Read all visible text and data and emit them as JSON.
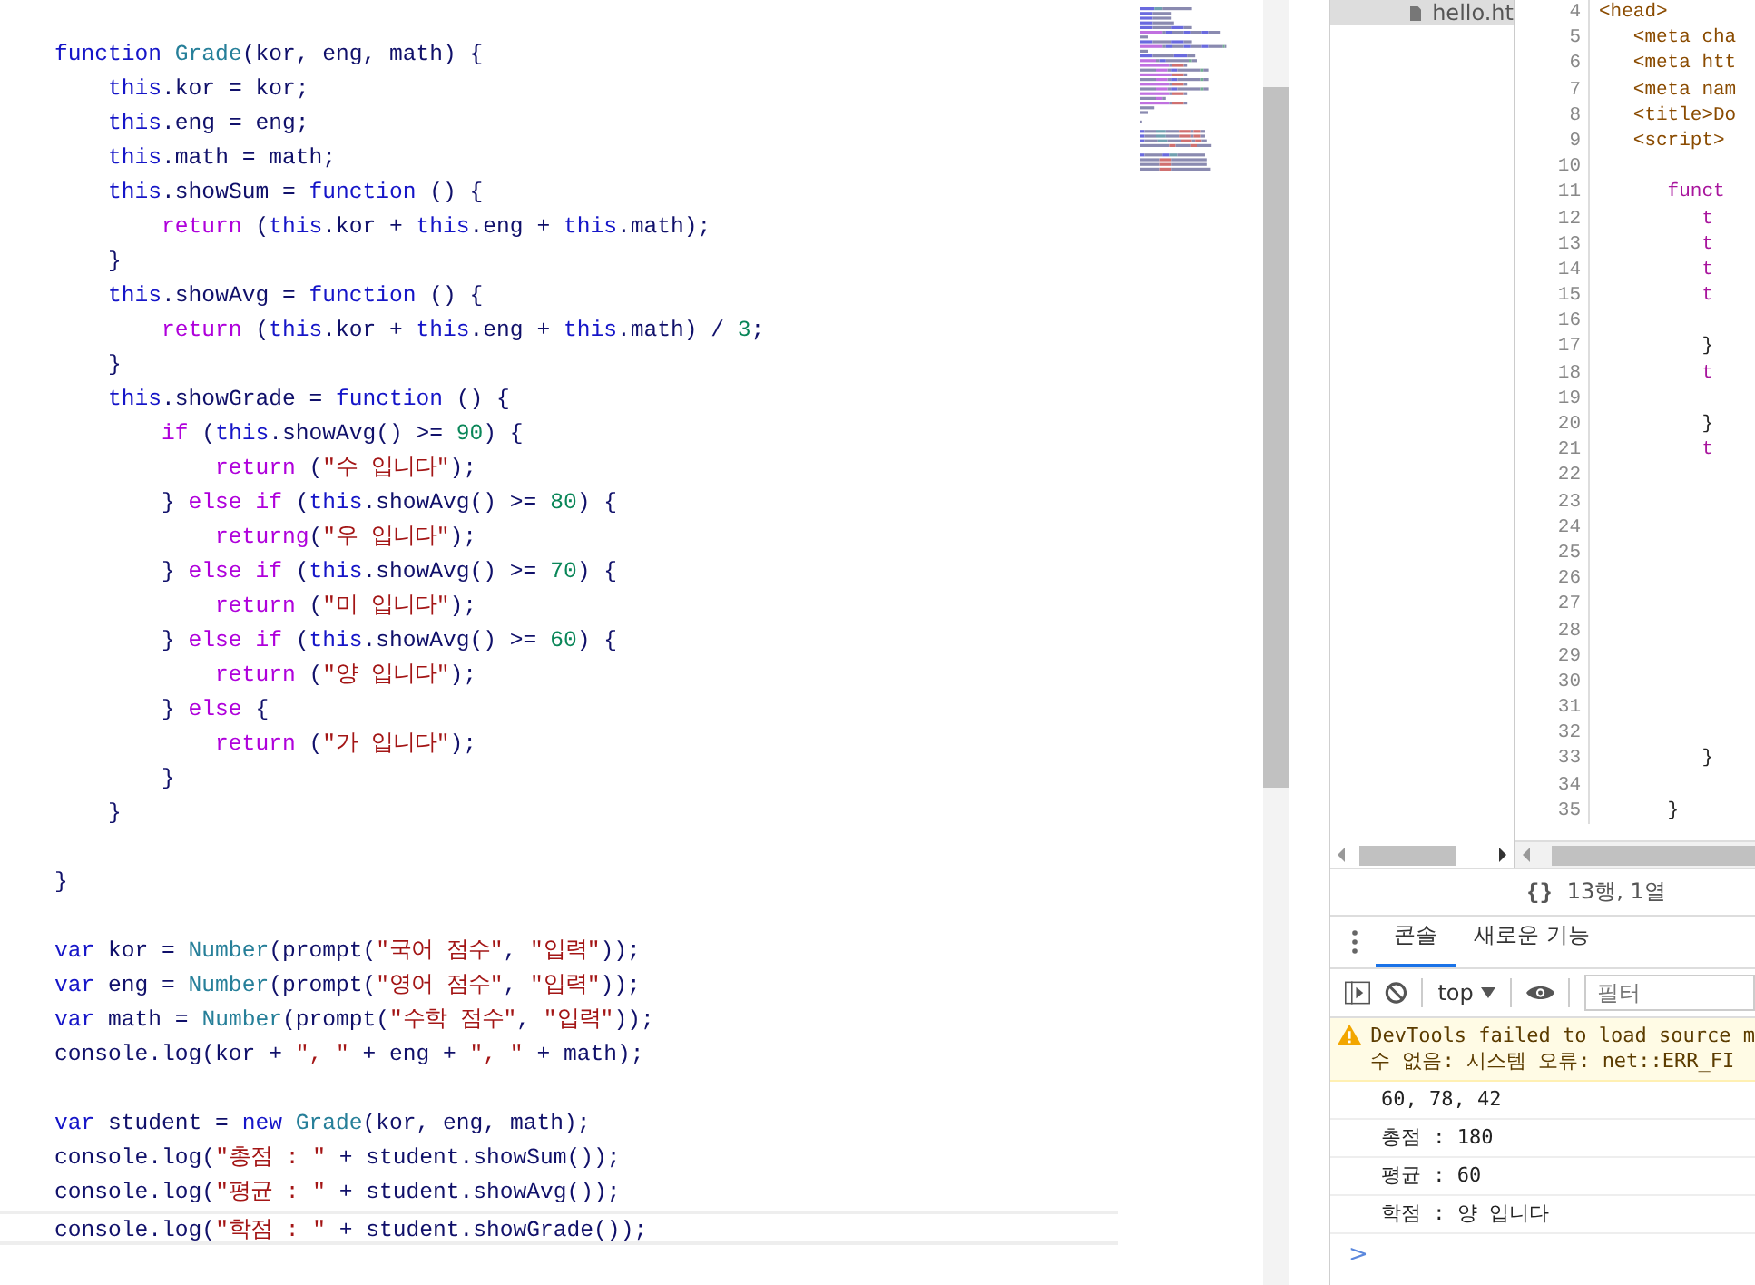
{
  "editor": {
    "blocks": [
      {
        "lines": [
          {
            "tokens": [
              {
                "kind": "kw",
                "text": "function "
              },
              {
                "kind": "type",
                "text": "Grade"
              },
              {
                "kind": "plain",
                "text": "(kor, eng, math) {"
              }
            ]
          },
          {
            "tokens": [
              {
                "kind": "kw",
                "text": "    this"
              },
              {
                "kind": "plain",
                "text": ".kor = kor;"
              }
            ]
          },
          {
            "tokens": [
              {
                "kind": "kw",
                "text": "    this"
              },
              {
                "kind": "plain",
                "text": ".eng = eng;"
              }
            ]
          },
          {
            "tokens": [
              {
                "kind": "kw",
                "text": "    this"
              },
              {
                "kind": "plain",
                "text": ".math = math;"
              }
            ]
          },
          {
            "tokens": [
              {
                "kind": "kw",
                "text": "    this"
              },
              {
                "kind": "plain",
                "text": ".showSum = "
              },
              {
                "kind": "kw",
                "text": "function"
              },
              {
                "kind": "plain",
                "text": " () {"
              }
            ]
          },
          {
            "tokens": [
              {
                "kind": "ctl",
                "text": "        return"
              },
              {
                "kind": "plain",
                "text": " ("
              },
              {
                "kind": "kw",
                "text": "this"
              },
              {
                "kind": "plain",
                "text": ".kor + "
              },
              {
                "kind": "kw",
                "text": "this"
              },
              {
                "kind": "plain",
                "text": ".eng + "
              },
              {
                "kind": "kw",
                "text": "this"
              },
              {
                "kind": "plain",
                "text": ".math);"
              }
            ]
          },
          {
            "tokens": [
              {
                "kind": "plain",
                "text": "    }"
              }
            ]
          },
          {
            "tokens": [
              {
                "kind": "kw",
                "text": "    this"
              },
              {
                "kind": "plain",
                "text": ".showAvg = "
              },
              {
                "kind": "kw",
                "text": "function"
              },
              {
                "kind": "plain",
                "text": " () {"
              }
            ]
          },
          {
            "tokens": [
              {
                "kind": "ctl",
                "text": "        return"
              },
              {
                "kind": "plain",
                "text": " ("
              },
              {
                "kind": "kw",
                "text": "this"
              },
              {
                "kind": "plain",
                "text": ".kor + "
              },
              {
                "kind": "kw",
                "text": "this"
              },
              {
                "kind": "plain",
                "text": ".eng + "
              },
              {
                "kind": "kw",
                "text": "this"
              },
              {
                "kind": "plain",
                "text": ".math) / "
              },
              {
                "kind": "num",
                "text": "3"
              },
              {
                "kind": "plain",
                "text": ";"
              }
            ]
          },
          {
            "tokens": [
              {
                "kind": "plain",
                "text": "    }"
              }
            ]
          },
          {
            "tokens": [
              {
                "kind": "kw",
                "text": "    this"
              },
              {
                "kind": "plain",
                "text": ".showGrade = "
              },
              {
                "kind": "kw",
                "text": "function"
              },
              {
                "kind": "plain",
                "text": " () {"
              }
            ]
          },
          {
            "tokens": [
              {
                "kind": "ctl",
                "text": "        if"
              },
              {
                "kind": "plain",
                "text": " ("
              },
              {
                "kind": "kw",
                "text": "this"
              },
              {
                "kind": "plain",
                "text": ".showAvg() >= "
              },
              {
                "kind": "num",
                "text": "90"
              },
              {
                "kind": "plain",
                "text": ") {"
              }
            ]
          },
          {
            "tokens": [
              {
                "kind": "ctl",
                "text": "            return"
              },
              {
                "kind": "plain",
                "text": " ("
              },
              {
                "kind": "str",
                "text": "\"수 입니다\""
              },
              {
                "kind": "plain",
                "text": ");"
              }
            ]
          },
          {
            "tokens": [
              {
                "kind": "plain",
                "text": "        } "
              },
              {
                "kind": "ctl",
                "text": "else if"
              },
              {
                "kind": "plain",
                "text": " ("
              },
              {
                "kind": "kw",
                "text": "this"
              },
              {
                "kind": "plain",
                "text": ".showAvg() >= "
              },
              {
                "kind": "num",
                "text": "80"
              },
              {
                "kind": "plain",
                "text": ") {"
              }
            ]
          },
          {
            "tokens": [
              {
                "kind": "ctl",
                "text": "            returng"
              },
              {
                "kind": "plain",
                "text": "("
              },
              {
                "kind": "str",
                "text": "\"우 입니다\""
              },
              {
                "kind": "plain",
                "text": ");"
              }
            ]
          },
          {
            "tokens": [
              {
                "kind": "plain",
                "text": "        } "
              },
              {
                "kind": "ctl",
                "text": "else if"
              },
              {
                "kind": "plain",
                "text": " ("
              },
              {
                "kind": "kw",
                "text": "this"
              },
              {
                "kind": "plain",
                "text": ".showAvg() >= "
              },
              {
                "kind": "num",
                "text": "70"
              },
              {
                "kind": "plain",
                "text": ") {"
              }
            ]
          },
          {
            "tokens": [
              {
                "kind": "ctl",
                "text": "            return"
              },
              {
                "kind": "plain",
                "text": " ("
              },
              {
                "kind": "str",
                "text": "\"미 입니다\""
              },
              {
                "kind": "plain",
                "text": ");"
              }
            ]
          },
          {
            "tokens": [
              {
                "kind": "plain",
                "text": "        } "
              },
              {
                "kind": "ctl",
                "text": "else if"
              },
              {
                "kind": "plain",
                "text": " ("
              },
              {
                "kind": "kw",
                "text": "this"
              },
              {
                "kind": "plain",
                "text": ".showAvg() >= "
              },
              {
                "kind": "num",
                "text": "60"
              },
              {
                "kind": "plain",
                "text": ") {"
              }
            ]
          },
          {
            "tokens": [
              {
                "kind": "ctl",
                "text": "            return"
              },
              {
                "kind": "plain",
                "text": " ("
              },
              {
                "kind": "str",
                "text": "\"양 입니다\""
              },
              {
                "kind": "plain",
                "text": ");"
              }
            ]
          },
          {
            "tokens": [
              {
                "kind": "plain",
                "text": "        } "
              },
              {
                "kind": "ctl",
                "text": "else"
              },
              {
                "kind": "plain",
                "text": " {"
              }
            ]
          },
          {
            "tokens": [
              {
                "kind": "ctl",
                "text": "            return"
              },
              {
                "kind": "plain",
                "text": " ("
              },
              {
                "kind": "str",
                "text": "\"가 입니다\""
              },
              {
                "kind": "plain",
                "text": ");"
              }
            ]
          },
          {
            "tokens": [
              {
                "kind": "plain",
                "text": "        }"
              }
            ]
          },
          {
            "tokens": [
              {
                "kind": "plain",
                "text": "    }"
              }
            ]
          }
        ]
      },
      {
        "lines": [
          {
            "tokens": [
              {
                "kind": "plain",
                "text": "}"
              }
            ]
          }
        ]
      },
      {
        "lines": [
          {
            "tokens": [
              {
                "kind": "kw",
                "text": "var"
              },
              {
                "kind": "plain",
                "text": " kor = "
              },
              {
                "kind": "type",
                "text": "Number"
              },
              {
                "kind": "plain",
                "text": "(prompt("
              },
              {
                "kind": "str",
                "text": "\"국어 점수\""
              },
              {
                "kind": "plain",
                "text": ", "
              },
              {
                "kind": "str",
                "text": "\"입력\""
              },
              {
                "kind": "plain",
                "text": "));"
              }
            ]
          },
          {
            "tokens": [
              {
                "kind": "kw",
                "text": "var"
              },
              {
                "kind": "plain",
                "text": " eng = "
              },
              {
                "kind": "type",
                "text": "Number"
              },
              {
                "kind": "plain",
                "text": "(prompt("
              },
              {
                "kind": "str",
                "text": "\"영어 점수\""
              },
              {
                "kind": "plain",
                "text": ", "
              },
              {
                "kind": "str",
                "text": "\"입력\""
              },
              {
                "kind": "plain",
                "text": "));"
              }
            ]
          },
          {
            "tokens": [
              {
                "kind": "kw",
                "text": "var"
              },
              {
                "kind": "plain",
                "text": " math = "
              },
              {
                "kind": "type",
                "text": "Number"
              },
              {
                "kind": "plain",
                "text": "(prompt("
              },
              {
                "kind": "str",
                "text": "\"수학 점수\""
              },
              {
                "kind": "plain",
                "text": ", "
              },
              {
                "kind": "str",
                "text": "\"입력\""
              },
              {
                "kind": "plain",
                "text": "));"
              }
            ]
          },
          {
            "tokens": [
              {
                "kind": "plain",
                "text": "console.log(kor + "
              },
              {
                "kind": "str",
                "text": "\", \""
              },
              {
                "kind": "plain",
                "text": " + eng + "
              },
              {
                "kind": "str",
                "text": "\", \""
              },
              {
                "kind": "plain",
                "text": " + math);"
              }
            ]
          }
        ]
      },
      {
        "lines": [
          {
            "tokens": [
              {
                "kind": "kw",
                "text": "var"
              },
              {
                "kind": "plain",
                "text": " student = "
              },
              {
                "kind": "kw",
                "text": "new "
              },
              {
                "kind": "type",
                "text": "Grade"
              },
              {
                "kind": "plain",
                "text": "(kor, eng, math);"
              }
            ]
          },
          {
            "tokens": [
              {
                "kind": "plain",
                "text": "console.log("
              },
              {
                "kind": "str",
                "text": "\"총점 : \""
              },
              {
                "kind": "plain",
                "text": " + student.showSum());"
              }
            ]
          },
          {
            "tokens": [
              {
                "kind": "plain",
                "text": "console.log("
              },
              {
                "kind": "str",
                "text": "\"평균 : \""
              },
              {
                "kind": "plain",
                "text": " + student.showAvg());"
              }
            ]
          },
          {
            "tokens": [
              {
                "kind": "plain",
                "text": "console.log("
              },
              {
                "kind": "str",
                "text": "\"학점 : \""
              },
              {
                "kind": "plain",
                "text": " + student.showGrade());"
              }
            ]
          }
        ]
      }
    ]
  },
  "devtools": {
    "file_tree": {
      "items": [
        {
          "label": "hello.ht",
          "selected": true
        }
      ]
    },
    "source": {
      "lines": [
        {
          "number": "4",
          "kind": "tag",
          "text": "<head>"
        },
        {
          "number": "5",
          "kind": "tag",
          "text": "   <meta cha"
        },
        {
          "number": "6",
          "kind": "tag",
          "text": "   <meta htt"
        },
        {
          "number": "7",
          "kind": "tag",
          "text": "   <meta nam"
        },
        {
          "number": "8",
          "kind": "tag",
          "text": "   <title>Do"
        },
        {
          "number": "9",
          "kind": "tag",
          "text": "   <script>"
        },
        {
          "number": "10"
        },
        {
          "number": "11",
          "kind": "kw",
          "text": "      funct"
        },
        {
          "number": "12",
          "kind": "kw",
          "text": "         t"
        },
        {
          "number": "13",
          "kind": "kw",
          "text": "         t"
        },
        {
          "number": "14",
          "kind": "kw",
          "text": "         t"
        },
        {
          "number": "15",
          "kind": "kw",
          "text": "         t"
        },
        {
          "number": "16"
        },
        {
          "number": "17",
          "kind": "plain",
          "text": "         }"
        },
        {
          "number": "18",
          "kind": "kw",
          "text": "         t"
        },
        {
          "number": "19"
        },
        {
          "number": "20",
          "kind": "plain",
          "text": "         }"
        },
        {
          "number": "21",
          "kind": "kw",
          "text": "         t"
        },
        {
          "number": "22"
        },
        {
          "number": "23"
        },
        {
          "number": "24"
        },
        {
          "number": "25"
        },
        {
          "number": "26"
        },
        {
          "number": "27"
        },
        {
          "number": "28"
        },
        {
          "number": "29"
        },
        {
          "number": "30"
        },
        {
          "number": "31"
        },
        {
          "number": "32"
        },
        {
          "number": "33",
          "kind": "plain",
          "text": "         }"
        },
        {
          "number": "34"
        },
        {
          "number": "35",
          "kind": "plain",
          "text": "      }"
        }
      ]
    },
    "status_bar": {
      "braces": "{}",
      "position": "13행, 1열"
    },
    "tabs": [
      {
        "label": "콘솔",
        "selected": true
      },
      {
        "label": "새로운 기능",
        "selected": false
      }
    ],
    "console_toolbar": {
      "context": "top",
      "filter_placeholder": "필터"
    },
    "messages": [
      {
        "kind": "warning",
        "lines": [
          "DevTools failed to load source m",
          "수 없음: 시스템 오류: net::ERR_FI"
        ]
      },
      {
        "kind": "log",
        "lines": [
          "60, 78, 42"
        ]
      },
      {
        "kind": "log",
        "lines": [
          "총점 : 180"
        ]
      },
      {
        "kind": "log",
        "lines": [
          "평균 : 60"
        ]
      },
      {
        "kind": "log",
        "lines": [
          "학점 : 양 입니다"
        ]
      }
    ],
    "prompt": ">"
  }
}
